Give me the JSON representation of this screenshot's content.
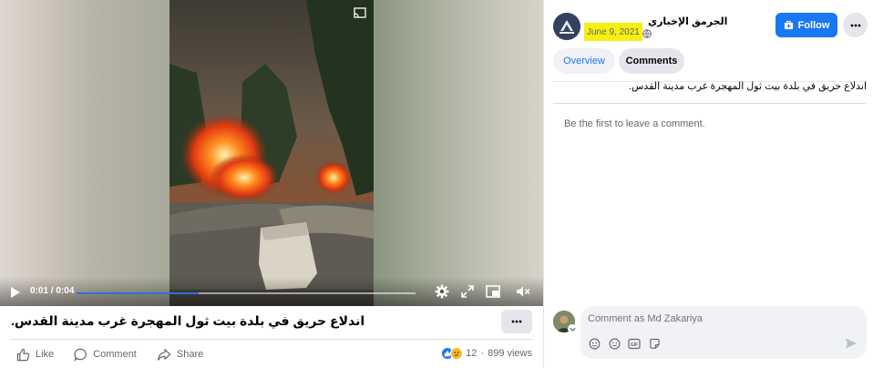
{
  "video": {
    "current_time": "0:01",
    "duration": "0:04",
    "progress": 0.36
  },
  "post": {
    "caption": "اندلاع حريق في بلدة بيت ثول المهجرة غرب مدينة القدس.",
    "actions": {
      "like": "Like",
      "comment": "Comment",
      "share": "Share"
    },
    "reaction_count": "12",
    "views": "899 views"
  },
  "sidebar": {
    "page_name": "الجرمق الإخباري",
    "date": "June 9, 2021",
    "date_separator": "·",
    "follow_label": "Follow",
    "tabs": {
      "overview": "Overview",
      "comments": "Comments"
    },
    "post_text": "اندلاع حريق في بلدة بيت ثول المهجرة غرب مدينة القدس.",
    "empty_note": "Be the first to leave a comment.",
    "comment_placeholder": "Comment as Md Zakariya"
  },
  "colors": {
    "accent": "#1877f2",
    "date_highlight": "#f5ef13",
    "secondary_text": "#65676b"
  }
}
